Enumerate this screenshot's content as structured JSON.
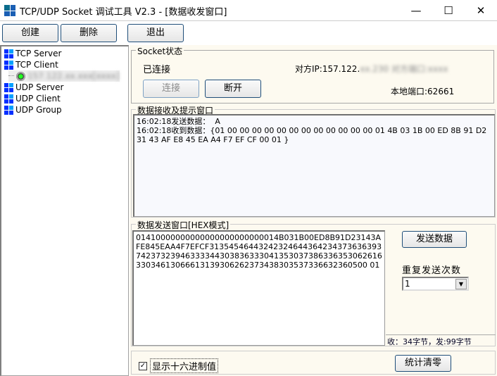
{
  "window": {
    "title": "TCP/UDP Socket 调试工具 V2.3 - [数据收发窗口]",
    "minimize": "—",
    "maximize": "☐",
    "close": "✕"
  },
  "toolbar": {
    "create": "创建",
    "delete": "删除",
    "exit": "退出"
  },
  "tree": {
    "items": [
      "TCP Server",
      "TCP Client",
      "UDP Server",
      "UDP Client",
      "UDP Group"
    ],
    "client_node": "157.122.xx.xxx[xxxx]"
  },
  "socket": {
    "group_label": "Socket状态",
    "status": "已连接",
    "remote_ip_label": "对方IP:157.122.",
    "remote_ip_hidden": "xx.230 对方端口:xxxx",
    "connect": "连接",
    "disconnect": "断开",
    "local_port": "本地端口:62661"
  },
  "receive": {
    "group_label": "数据接收及提示窗口",
    "log": "16:02:18发送数据：  A\n16:02:18收到数据：{01 00 00 00 00 00 00 00 00 00 00 00 00 01 4B 03 1B 00 ED 8B 91 D2 31 43 AF E8 45 EA A4 F7 EF CF 00 01 }"
  },
  "send": {
    "group_label": "数据发送窗口[HEX模式]",
    "content": "01410000000000000000000000014B031B00ED8B91D23143AFE845EAA4F7EFCF313545464432423246443642343736363937423732394633334430383633304135303738633635306261633034613066613139306262373438303537336632360500 01",
    "send_button": "发送数据",
    "repeat_label": "重复发送次数",
    "repeat_value": "1",
    "stats": "收：34字节，发:99字节"
  },
  "bottom": {
    "hex_checkbox": "显示十六进制值",
    "hex_checked": true,
    "reset_stats": "统计清零"
  }
}
